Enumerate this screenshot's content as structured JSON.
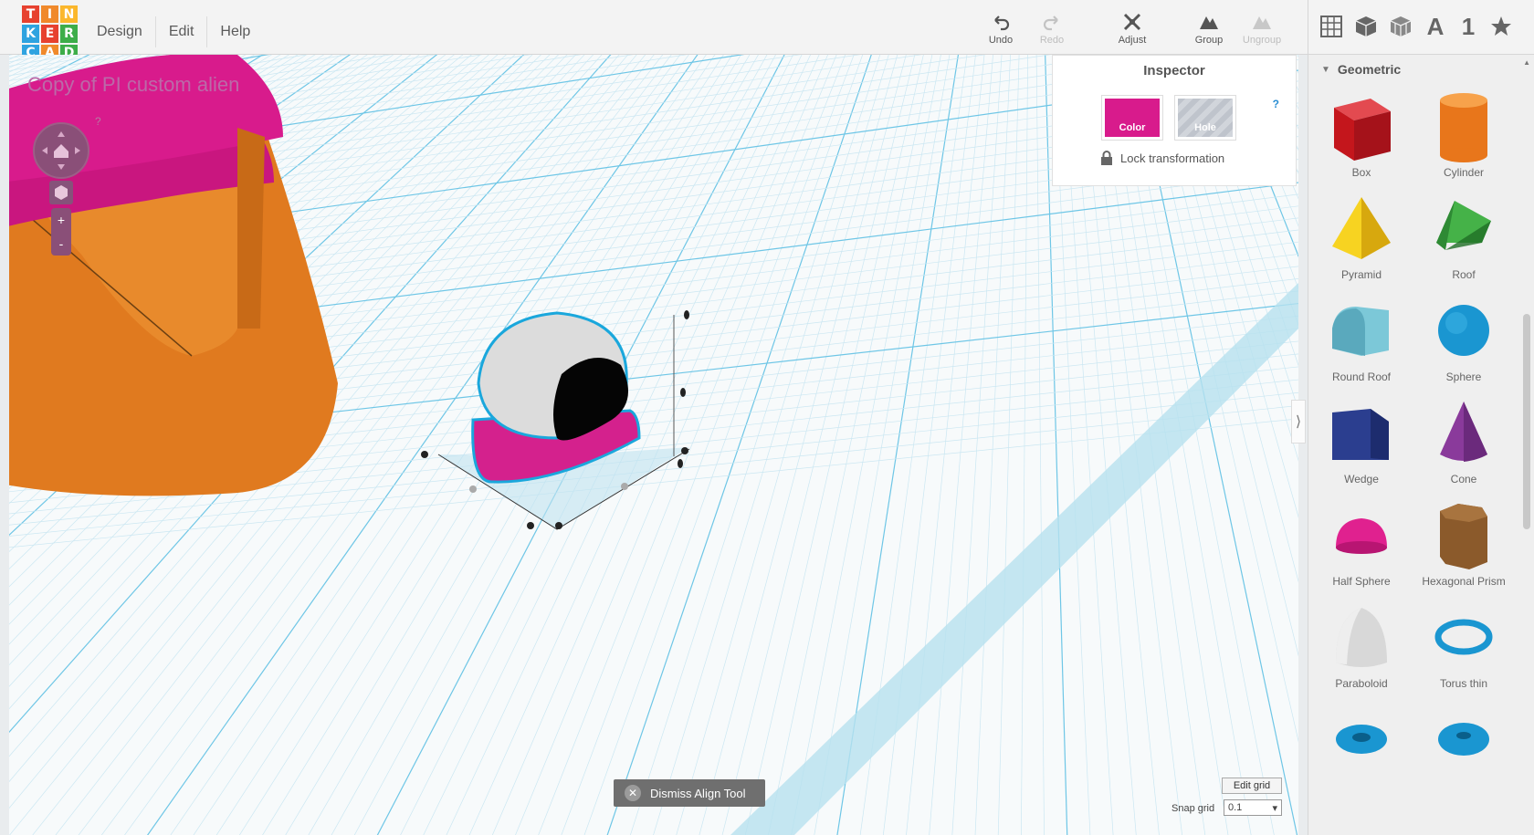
{
  "app": {
    "logo_letters": [
      "T",
      "I",
      "N",
      "K",
      "E",
      "R",
      "C",
      "A",
      "D"
    ],
    "logo_colors": [
      "#e7412f",
      "#f0892b",
      "#fbb72c",
      "#2ea3e0",
      "#e7412f",
      "#3dad49",
      "#2ea3e0",
      "#f0892b",
      "#3dad49"
    ]
  },
  "menu": {
    "items": [
      "Design",
      "Edit",
      "Help"
    ]
  },
  "toolbar": {
    "undo": "Undo",
    "redo": "Redo",
    "adjust": "Adjust",
    "group": "Group",
    "ungroup": "Ungroup"
  },
  "views": {
    "icons": [
      "grid-view-icon",
      "box-view-icon",
      "wireframe-view-icon",
      "text-icon",
      "number-icon",
      "star-icon"
    ],
    "text_label": "A",
    "number_label": "1"
  },
  "project": {
    "title": "Copy of PI custom alien",
    "help": "?"
  },
  "inspector": {
    "title": "Inspector",
    "color_label": "Color",
    "hole_label": "Hole",
    "help": "?",
    "lock_label": "Lock transformation",
    "color_value": "#d81b8c"
  },
  "shapes": {
    "category": "Geometric",
    "items": [
      {
        "label": "Box",
        "icon": "box-icon"
      },
      {
        "label": "Cylinder",
        "icon": "cylinder-icon"
      },
      {
        "label": "Pyramid",
        "icon": "pyramid-icon"
      },
      {
        "label": "Roof",
        "icon": "roof-icon"
      },
      {
        "label": "Round Roof",
        "icon": "round-roof-icon"
      },
      {
        "label": "Sphere",
        "icon": "sphere-icon"
      },
      {
        "label": "Wedge",
        "icon": "wedge-icon"
      },
      {
        "label": "Cone",
        "icon": "cone-icon"
      },
      {
        "label": "Half Sphere",
        "icon": "half-sphere-icon"
      },
      {
        "label": "Hexagonal Prism",
        "icon": "hex-prism-icon"
      },
      {
        "label": "Paraboloid",
        "icon": "paraboloid-icon"
      },
      {
        "label": "Torus thin",
        "icon": "torus-thin-icon"
      }
    ]
  },
  "bottom": {
    "dismiss_label": "Dismiss Align Tool",
    "edit_grid": "Edit grid",
    "snap_label": "Snap grid",
    "snap_value": "0.1"
  }
}
